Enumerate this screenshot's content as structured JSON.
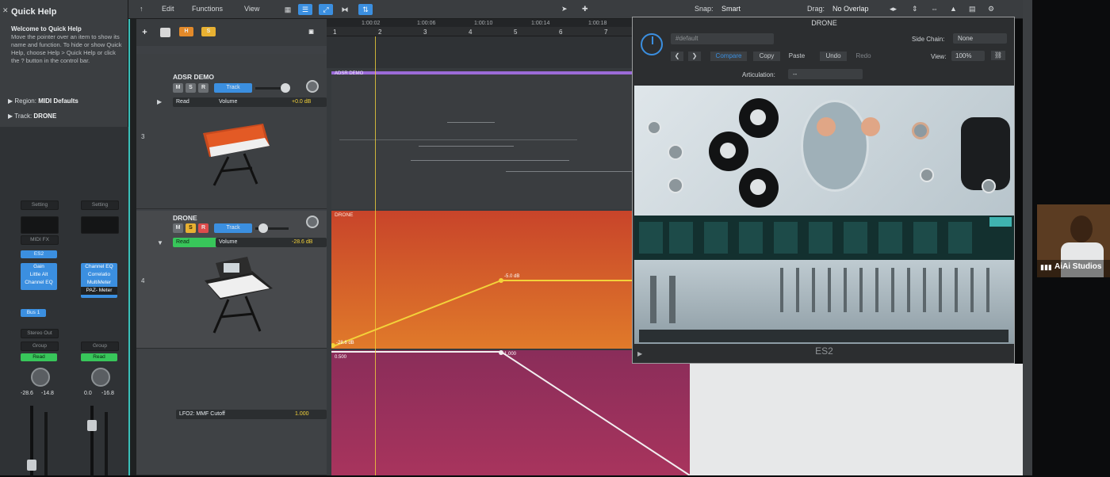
{
  "quick_help": {
    "close": "✕",
    "title": "Quick Help",
    "heading": "Welcome to Quick Help",
    "body": "Move the pointer over an item to show its name and function. To hide or show Quick Help, choose Help > Quick Help or click the ? button in the control bar.",
    "region_label": "Region:",
    "region_value": "MIDI Defaults",
    "track_label": "Track:",
    "track_value": "DRONE"
  },
  "mixer": {
    "strip1": {
      "setting": "Setting",
      "eq": "",
      "midi_fx": "MIDI FX",
      "instrument": "ES2",
      "inserts": [
        "Gain",
        "Little Alt",
        "Channel EQ"
      ],
      "send": "Bus 1",
      "output": "Stereo Out",
      "group": "Group",
      "automation": "Read",
      "vol": "-28.6",
      "peak": "-14.8"
    },
    "strip2": {
      "setting": "Setting",
      "inserts": [
        "Channel EQ",
        "Correlatio",
        "MultiMeter",
        "PAZ- Meter"
      ],
      "group": "Group",
      "automation": "Read",
      "vol": "0.0",
      "peak": "-16.8"
    }
  },
  "toolbar": {
    "back": "↑",
    "edit": "Edit",
    "functions": "Functions",
    "view": "View",
    "snap_label": "Snap:",
    "snap_value": "Smart",
    "drag_label": "Drag:",
    "drag_value": "No Overlap"
  },
  "tracks": [
    {
      "num": "3",
      "name": "ADSR DEMO",
      "m": "M",
      "s": "S",
      "r": "R",
      "mode": "Track",
      "automation": "Read",
      "param": "Volume",
      "value": "+0.0 dB"
    },
    {
      "num": "4",
      "name": "DRONE",
      "m": "M",
      "s": "S",
      "r": "R",
      "mode": "Track",
      "automation": "Read",
      "param": "Volume",
      "value": "-28.6 dB"
    },
    {
      "lane_param": "LFO2: MMF Cutoff",
      "lane_value": "1.000"
    }
  ],
  "track_header_buttons": {
    "add": "+",
    "h": "H",
    "s": "S"
  },
  "ruler": {
    "bars": [
      "1",
      "2",
      "3",
      "4",
      "5",
      "6",
      "7"
    ],
    "timecodes": [
      "1:00:02",
      "1:00:06",
      "1:00:10",
      "1:00:14",
      "1:00:18"
    ]
  },
  "regions": {
    "adsr_label": "ADSR DEMO",
    "drone_label": "DRONE",
    "auto_point_1": "-5.0 dB",
    "auto_point_0": "-28.6 dB",
    "lane_point": "1.000",
    "lane_start": "0.500"
  },
  "plugin": {
    "title": "DRONE",
    "preset": "#default",
    "side_chain_label": "Side Chain:",
    "side_chain_value": "None",
    "compare": "Compare",
    "copy": "Copy",
    "paste": "Paste",
    "undo": "Undo",
    "redo": "Redo",
    "view_label": "View:",
    "view_value": "100%",
    "articulation_label": "Articulation:",
    "articulation_value": "--",
    "instrument_name": "ES2"
  },
  "webcam": {
    "label": "AiAi Studios"
  },
  "colors": {
    "accent": "#3b8fe0",
    "green": "#38c65a",
    "yellow": "#f3d23a",
    "drone_region": "#d2522b",
    "lane_region": "#7a2a56"
  }
}
